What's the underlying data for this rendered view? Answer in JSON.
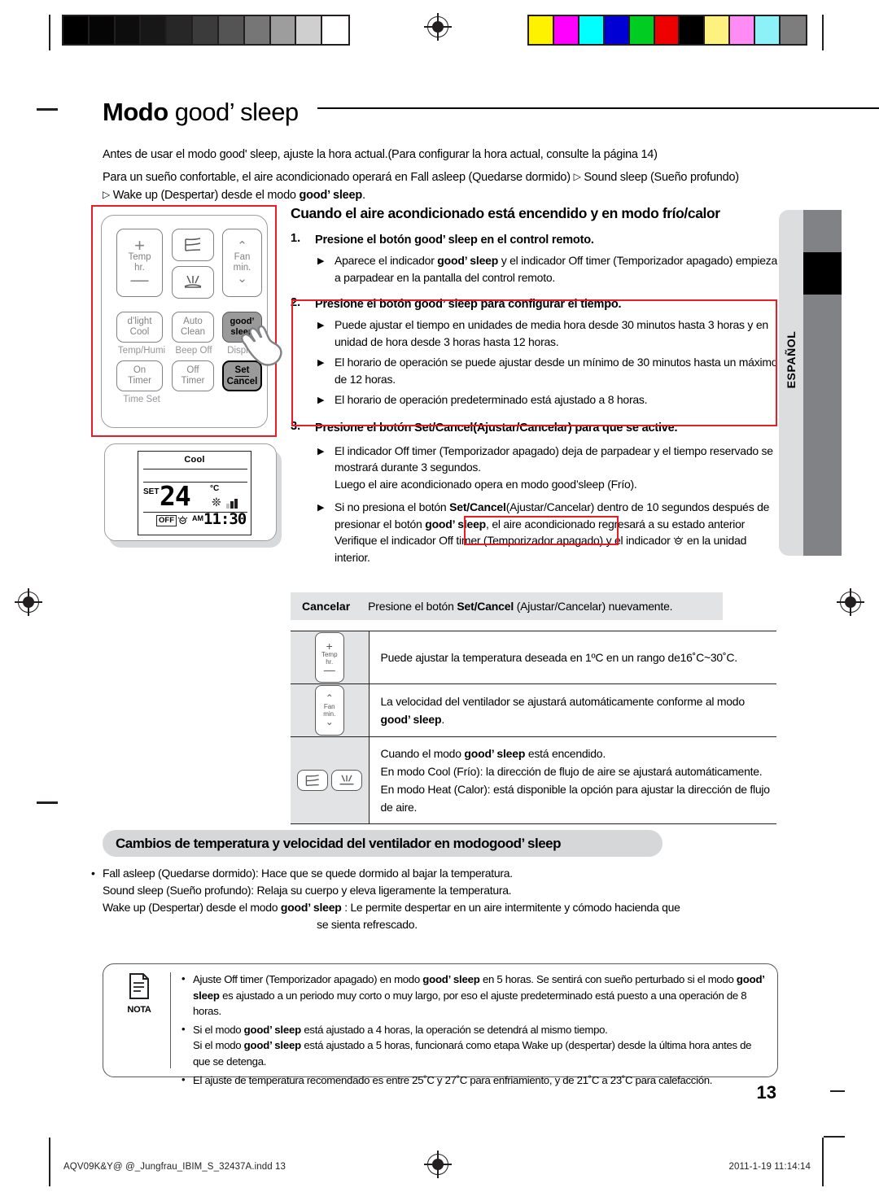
{
  "prepress": {
    "gray_swatches": [
      "#000000",
      "#050505",
      "#0d0d0d",
      "#171717",
      "#272727",
      "#3b3b3b",
      "#545454",
      "#767676",
      "#9d9d9d",
      "#cfcfcf",
      "#ffffff"
    ],
    "color_swatches": [
      "#fff200",
      "#ff00ff",
      "#00ffff",
      "#0000d4",
      "#00cc22",
      "#ee0000",
      "#000000",
      "#fdf280",
      "#ff8cf5",
      "#8cf2f7",
      "#7d7d7d"
    ]
  },
  "title": {
    "prefix": "Modo ",
    "brand": "good’ sleep"
  },
  "intro": {
    "line1": "Antes de usar el modo good' sleep, ajuste la hora actual.(Para configurar la hora actual, consulte la página 14)",
    "line2a": "Para un sueño confortable, el aire acondicionado operará en Fall asleep (Quedarse dormido) ",
    "line2b": " Sound sleep (Sueño profundo)",
    "line3a": " Wake up (Despertar) desde el modo ",
    "line3b": "good’ sleep",
    "line3c": "."
  },
  "remote": {
    "buttons": {
      "temp_plus": "+",
      "temp_label1": "Temp",
      "temp_label2": "hr.",
      "temp_minus": "—",
      "fan_up": "⌃",
      "fan_label1": "Fan",
      "fan_label2": "min.",
      "fan_down": "⌄",
      "dlight1": "d’light",
      "dlight2": "Cool",
      "auto1": "Auto",
      "auto2": "Clean",
      "good1": "good’",
      "good2": "sleep",
      "on1": "On",
      "on2": "Timer",
      "off1": "Off",
      "off2": "Timer",
      "set1": "Set",
      "set2": "Cancel"
    },
    "sublabels": {
      "temp_humi": "Temp/Humi",
      "beep_off": "Beep Off",
      "display": "Display",
      "time_set": "Time Set"
    }
  },
  "lcd": {
    "mode": "Cool",
    "set_label": "SET",
    "temperature": "24",
    "degree": "°C",
    "fan_icon": "❊",
    "fan_bars": [
      6,
      9,
      12
    ],
    "off_label": "OFF",
    "sleep_icon": "☼",
    "meridiem": "AM",
    "time": "11:30"
  },
  "section": {
    "heading": "Cuando el aire acondicionado está encendido y en modo frío/calor",
    "steps": [
      {
        "num": "1.",
        "title_a": "Presione el botón ",
        "title_brand": "good’ sleep",
        "title_b": " en el control remoto.",
        "bullets": [
          {
            "a": "Aparece el indicador ",
            "brand": "good’ sleep",
            "b": " y el indicador Off timer (Temporizador apagado) empieza a parpadear en la pantalla del control remoto."
          }
        ]
      },
      {
        "num": "2.",
        "title_a": "Presione el botón ",
        "title_brand": "good’ sleep",
        "title_b": " para configurar el tiempo.",
        "bullets": [
          {
            "a": "Puede ajustar el tiempo en unidades de media hora desde 30 minutos hasta 3 horas y en unidad de hora desde 3 horas hasta 12 horas.",
            "brand": "",
            "b": ""
          },
          {
            "a": "El horario de operación se puede ajustar desde un mínimo de 30 minutos hasta un máximo de 12 horas.",
            "brand": "",
            "b": ""
          },
          {
            "a": "El horario de operación predeterminado está ajustado a 8 horas.",
            "brand": "",
            "b": ""
          }
        ]
      },
      {
        "num": "3.",
        "title_a": "Presione el botón ",
        "title_brand": "Set/Cancel",
        "title_b": "(Ajustar/Cancelar) para que se active.",
        "bullets": [
          {
            "a": "El indicador Off timer (Temporizador apagado) deja de parpadear y el tiempo reservado se mostrará durante 3 segundos.",
            "a2": "Luego el aire acondicionado opera en modo good’sleep (Frío).",
            "brand": "",
            "b": ""
          },
          {
            "a": "Si no presiona el botón ",
            "brand": "Set/Cancel",
            "b": "(Ajustar/Cancelar) dentro de 10 segundos después de presionar el botón ",
            "brand2": "good’ sleep",
            "c": ", el aire acondicionado regresará a su estado anterior  Verifique el indicador Off timer (Temporizador apagado) y el indicador ",
            "icon": "☼",
            "d": " en la unidad interior."
          }
        ]
      }
    ]
  },
  "cancel_row": {
    "label": "Cancelar",
    "text_a": "Presione el botón ",
    "text_brand": "Set/Cancel",
    "text_b": " (Ajustar/Cancelar) nuevamente."
  },
  "feature_table": {
    "rows": [
      {
        "icon": "temp-button",
        "icon_top": "+",
        "icon_mid1": "Temp",
        "icon_mid2": "hr.",
        "icon_bot": "—",
        "text": "Puede ajustar la temperatura deseada en 1ºC en un rango de16˚C~30˚C."
      },
      {
        "icon": "fan-button",
        "icon_top": "⌃",
        "icon_mid1": "Fan",
        "icon_mid2": "min.",
        "icon_bot": "⌄",
        "text_a": "La velocidad del ventilador se ajustará automáticamente conforme al modo ",
        "text_brand": "good’ sleep",
        "text_b": "."
      },
      {
        "icon": "airflow-buttons",
        "line1_a": "Cuando el modo ",
        "line1_brand": "good’ sleep",
        "line1_b": " está encendido.",
        "line2": "En modo Cool (Frío): la dirección de flujo de aire se ajustará automáticamente.",
        "line3": "En modo Heat (Calor): está disponible la opción para ajustar la dirección de flujo de aire."
      }
    ]
  },
  "changes": {
    "heading_a": "Cambios de temperatura y velocidad del ventilador en modo ",
    "heading_brand": "good’ sleep",
    "line1": "Fall asleep (Quedarse dormido):  Hace que se quede dormido al bajar la temperatura.",
    "line2": "Sound sleep (Sueño profundo): Relaja su cuerpo y eleva ligeramente la temperatura.",
    "line3a": "Wake up (Despertar) desde el modo ",
    "line3brand": "good’ sleep",
    "line3b": " : Le permite despertar en un aire intermitente y cómodo hacienda que",
    "line4": "se sienta refrescado."
  },
  "nota": {
    "label": "NOTA",
    "items": [
      {
        "a": "Ajuste Off timer (Temporizador apagado) en modo ",
        "brand": "good’ sleep",
        "b": " en 5 horas. Se sentirá con sueño perturbado si el modo ",
        "brand2": "good’ sleep",
        "c": " es ajustado a un periodo muy corto o muy largo, por eso el ajuste predeterminado está puesto a una operación de 8 horas."
      },
      {
        "a": "Si el modo ",
        "brand": "good’ sleep",
        "b": " está ajustado a 4 horas, la operación se detendrá al mismo tiempo.",
        "a2": "Si el modo ",
        "brand2": "good’ sleep",
        "c": " está ajustado a 5 horas, funcionará como etapa Wake up (despertar) desde la última hora antes de que se detenga."
      },
      {
        "a": "El ajuste de temperatura recomendado es entre 25˚C y 27˚C para enfriamiento, y de 21˚C a 23˚C para calefacción.",
        "brand": "",
        "b": ""
      }
    ]
  },
  "page_number": "13",
  "language_tab": "ESPAÑOL",
  "footer": {
    "file": "AQV09K&Y@ @_Jungfrau_IBIM_S_32437A.indd   13",
    "timestamp": "2011-1-19   11:14:14"
  },
  "colors": {
    "highlight_red": "#ed1c24",
    "panel_gray": "#e2e3e4",
    "tab_gray": "#dcddde",
    "bar_gray": "#808285"
  }
}
